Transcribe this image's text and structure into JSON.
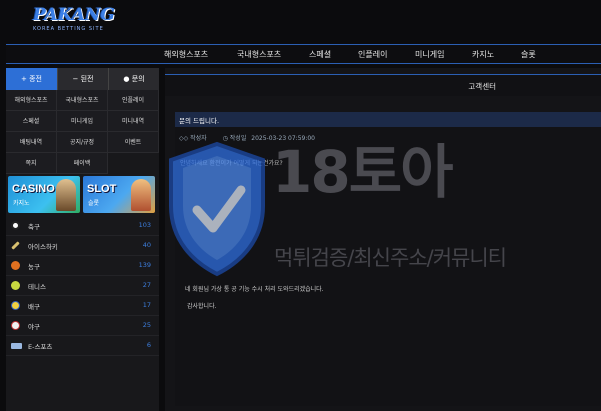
{
  "header": {
    "logo_text": "PAKANG",
    "logo_subtext": "KOREA BETTING SITE"
  },
  "topnav": {
    "items": [
      "해외형스포츠",
      "국내형스포츠",
      "스페셜",
      "인플레이",
      "미니게임",
      "카지노",
      "슬롯"
    ]
  },
  "sidebar": {
    "tabs": [
      "+ 종전",
      "− 된전",
      "● 문의"
    ],
    "menu": [
      "해외형스포츠",
      "국내형스포츠",
      "인플레이",
      "스페셜",
      "미니게임",
      "미니내역",
      "배팅내역",
      "공지/규정",
      "이벤트",
      "쪽지",
      "페이백"
    ],
    "banners": [
      {
        "title": "CASINO",
        "sub": "카지노"
      },
      {
        "title": "SLOT",
        "sub": "슬롯"
      }
    ],
    "sports": [
      {
        "name": "축구",
        "count": "103",
        "color": "#ffffff",
        "icon": "soccer-ball-icon"
      },
      {
        "name": "아이스하키",
        "count": "40",
        "color": "#d8c070",
        "icon": "hockey-stick-icon"
      },
      {
        "name": "농구",
        "count": "139",
        "color": "#e07020",
        "icon": "basketball-icon"
      },
      {
        "name": "테니스",
        "count": "27",
        "color": "#c8d840",
        "icon": "tennis-ball-icon"
      },
      {
        "name": "배구",
        "count": "17",
        "color": "#f0d040",
        "icon": "volleyball-icon"
      },
      {
        "name": "야구",
        "count": "25",
        "color": "#f0f0f0",
        "icon": "baseball-icon"
      },
      {
        "name": "E-스포츠",
        "count": "6",
        "color": "#9ab8e0",
        "icon": "esports-icon"
      }
    ]
  },
  "main": {
    "title": "고객센터",
    "question_title": "문의 드립니다.",
    "author_label": "작성자",
    "date_label": "작성일",
    "date_value": "2025-03-23 07:59:00",
    "question_text": "안녕하세요 환전이가 어떻게 되는건가요?",
    "answer_text": "네 회원님 가상 통 공 기능 수시 처리 도와드리겠습니다.",
    "answer_regards": "감사합니다."
  },
  "watermark": {
    "brand": "18토아",
    "tagline": "먹튀검증/최신주소/커뮤니티"
  },
  "colors": {
    "accent": "#2d6fd6",
    "background": "#0b0b0d",
    "count": "#3d7fe0"
  }
}
